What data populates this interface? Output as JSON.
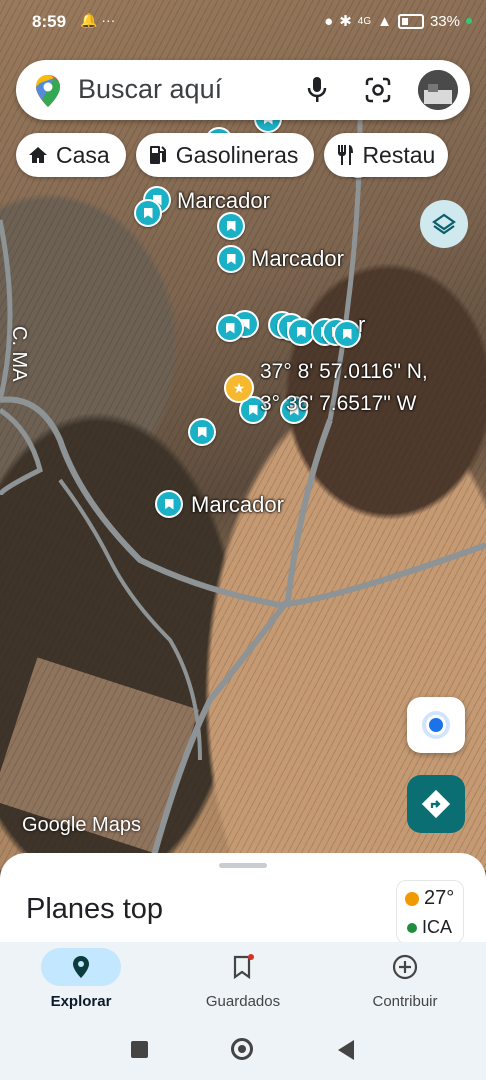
{
  "status_bar": {
    "time": "8:59",
    "battery": "33%",
    "network": "4G"
  },
  "search": {
    "placeholder": "Buscar aquí"
  },
  "chips": [
    {
      "label": "Casa",
      "icon": "home-icon"
    },
    {
      "label": "Gasolineras",
      "icon": "gas-station-icon"
    },
    {
      "label": "Restau",
      "icon": "restaurant-icon"
    }
  ],
  "map": {
    "marker_label_1": "Marcador",
    "marker_label_2": "Marcador",
    "marker_label_3": "Marcador",
    "marker_label_4_partial": "r",
    "coord_lat": "37° 8' 57.0116\" N,",
    "coord_lon": "3° 36' 7.6517\" W",
    "street_label": "C. MA",
    "logo": "Google Maps"
  },
  "sheet": {
    "title": "Planes top",
    "weather_temp": "27°",
    "aqi_label": "ICA"
  },
  "bottom_nav": [
    {
      "label": "Explorar",
      "icon": "explore-pin-icon",
      "active": true
    },
    {
      "label": "Guardados",
      "icon": "bookmark-icon",
      "active": false
    },
    {
      "label": "Contribuir",
      "icon": "add-circle-icon",
      "active": false
    }
  ],
  "colors": {
    "marker": "#1ab1c6",
    "directions_button": "#0b6e73",
    "active_nav_pill": "#c2e7ff"
  }
}
